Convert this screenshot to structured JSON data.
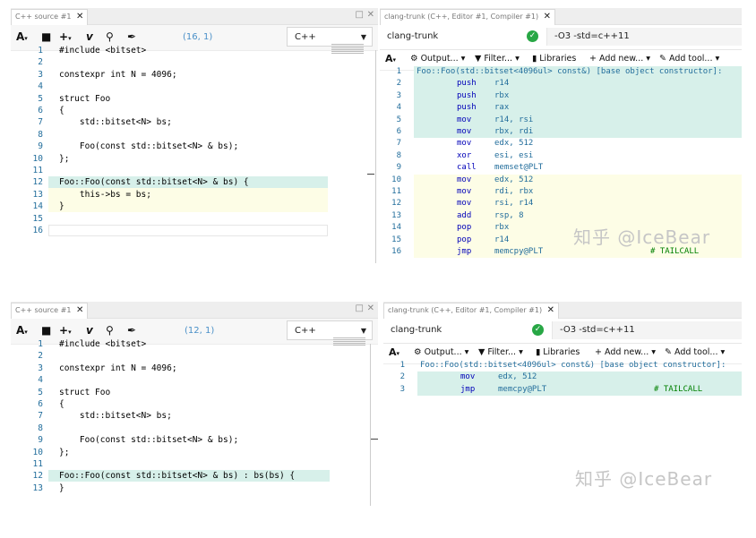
{
  "top": {
    "editor": {
      "tab_label": "C++ source #1",
      "cursor_pos": "(16, 1)",
      "language": "C++",
      "lines": [
        {
          "n": "1",
          "t": "#include <bitset>"
        },
        {
          "n": "2",
          "t": ""
        },
        {
          "n": "3",
          "t": "constexpr int N = 4096;"
        },
        {
          "n": "4",
          "t": ""
        },
        {
          "n": "5",
          "t": "struct Foo"
        },
        {
          "n": "6",
          "t": "{"
        },
        {
          "n": "7",
          "t": "    std::bitset<N> bs;"
        },
        {
          "n": "8",
          "t": ""
        },
        {
          "n": "9",
          "t": "    Foo(const std::bitset<N> & bs);"
        },
        {
          "n": "10",
          "t": "};"
        },
        {
          "n": "11",
          "t": ""
        },
        {
          "n": "12",
          "t": "Foo::Foo(const std::bitset<N> & bs) {"
        },
        {
          "n": "13",
          "t": "    this->bs = bs;"
        },
        {
          "n": "14",
          "t": "}"
        },
        {
          "n": "15",
          "t": ""
        },
        {
          "n": "16",
          "t": ""
        }
      ]
    },
    "compiler": {
      "tab_label": "clang-trunk (C++, Editor #1, Compiler #1)",
      "compiler_name": "clang-trunk",
      "options": "-O3 -std=c++11",
      "toolbar": {
        "font": "A",
        "output": "Output...",
        "filter": "Filter...",
        "libraries": "Libraries",
        "add_new": "Add new...",
        "add_tool": "Add tool..."
      },
      "asm": [
        {
          "n": "1",
          "label": "Foo::Foo(std::bitset<4096ul> const&) [base object constructor]:",
          "op": "",
          "arg": "",
          "cmt": ""
        },
        {
          "n": "2",
          "label": "",
          "op": "push",
          "arg": "r14",
          "cmt": ""
        },
        {
          "n": "3",
          "label": "",
          "op": "push",
          "arg": "rbx",
          "cmt": ""
        },
        {
          "n": "4",
          "label": "",
          "op": "push",
          "arg": "rax",
          "cmt": ""
        },
        {
          "n": "5",
          "label": "",
          "op": "mov",
          "arg": "r14, rsi",
          "cmt": ""
        },
        {
          "n": "6",
          "label": "",
          "op": "mov",
          "arg": "rbx, rdi",
          "cmt": ""
        },
        {
          "n": "7",
          "label": "",
          "op": "mov",
          "arg": "edx, 512",
          "cmt": ""
        },
        {
          "n": "8",
          "label": "",
          "op": "xor",
          "arg": "esi, esi",
          "cmt": ""
        },
        {
          "n": "9",
          "label": "",
          "op": "call",
          "arg": "memset@PLT",
          "cmt": ""
        },
        {
          "n": "10",
          "label": "",
          "op": "mov",
          "arg": "edx, 512",
          "cmt": ""
        },
        {
          "n": "11",
          "label": "",
          "op": "mov",
          "arg": "rdi, rbx",
          "cmt": ""
        },
        {
          "n": "12",
          "label": "",
          "op": "mov",
          "arg": "rsi, r14",
          "cmt": ""
        },
        {
          "n": "13",
          "label": "",
          "op": "add",
          "arg": "rsp, 8",
          "cmt": ""
        },
        {
          "n": "14",
          "label": "",
          "op": "pop",
          "arg": "rbx",
          "cmt": ""
        },
        {
          "n": "15",
          "label": "",
          "op": "pop",
          "arg": "r14",
          "cmt": ""
        },
        {
          "n": "16",
          "label": "",
          "op": "jmp",
          "arg": "memcpy@PLT",
          "cmt": "# TAILCALL"
        }
      ],
      "watermark": "知乎 @IceBear"
    }
  },
  "bottom": {
    "editor": {
      "tab_label": "C++ source #1",
      "cursor_pos": "(12, 1)",
      "language": "C++",
      "lines": [
        {
          "n": "1",
          "t": "#include <bitset>"
        },
        {
          "n": "2",
          "t": ""
        },
        {
          "n": "3",
          "t": "constexpr int N = 4096;"
        },
        {
          "n": "4",
          "t": ""
        },
        {
          "n": "5",
          "t": "struct Foo"
        },
        {
          "n": "6",
          "t": "{"
        },
        {
          "n": "7",
          "t": "    std::bitset<N> bs;"
        },
        {
          "n": "8",
          "t": ""
        },
        {
          "n": "9",
          "t": "    Foo(const std::bitset<N> & bs);"
        },
        {
          "n": "10",
          "t": "};"
        },
        {
          "n": "11",
          "t": ""
        },
        {
          "n": "12",
          "t": "Foo::Foo(const std::bitset<N> & bs) : bs(bs) {"
        },
        {
          "n": "13",
          "t": "}"
        }
      ]
    },
    "compiler": {
      "tab_label": "clang-trunk (C++, Editor #1, Compiler #1)",
      "compiler_name": "clang-trunk",
      "options": "-O3 -std=c++11",
      "toolbar": {
        "font": "A",
        "output": "Output...",
        "filter": "Filter...",
        "libraries": "Libraries",
        "add_new": "Add new...",
        "add_tool": "Add tool..."
      },
      "asm": [
        {
          "n": "1",
          "label": "Foo::Foo(std::bitset<4096ul> const&) [base object constructor]:",
          "op": "",
          "arg": "",
          "cmt": ""
        },
        {
          "n": "2",
          "label": "",
          "op": "mov",
          "arg": "edx, 512",
          "cmt": ""
        },
        {
          "n": "3",
          "label": "",
          "op": "jmp",
          "arg": "memcpy@PLT",
          "cmt": "# TAILCALL"
        }
      ],
      "watermark": "知乎 @IceBear"
    }
  },
  "icons": [
    "font-icon",
    "save-icon",
    "add-icon",
    "vim-icon",
    "search-icon",
    "pin-icon",
    "maximize-icon",
    "close-icon",
    "check-icon",
    "settings-icon",
    "filter-icon",
    "book-icon",
    "plus-icon",
    "wrench-icon"
  ]
}
